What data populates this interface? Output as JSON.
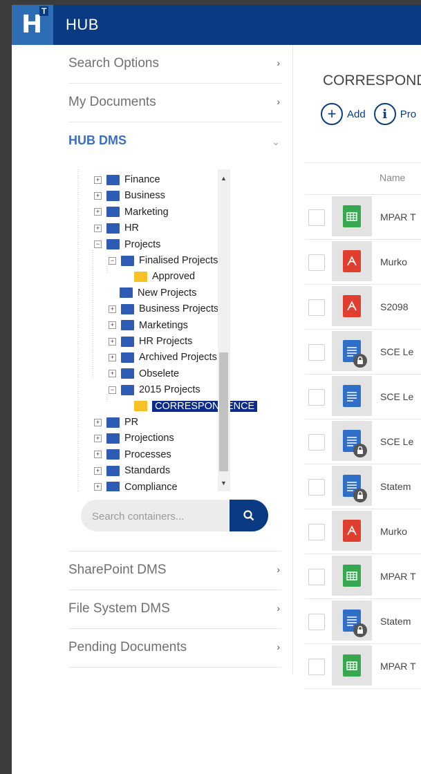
{
  "header": {
    "logo_letter": "H",
    "logo_mark": "T",
    "app_title": "HUB"
  },
  "sidebar": {
    "items_top": [
      {
        "label": "Search Options",
        "chevron": ">"
      },
      {
        "label": "My Documents",
        "chevron": ">"
      },
      {
        "label": "HUB DMS",
        "chevron": "v",
        "active": true
      }
    ],
    "items_bottom": [
      {
        "label": "SharePoint DMS",
        "chevron": ">"
      },
      {
        "label": "File System DMS",
        "chevron": ">"
      },
      {
        "label": "Pending Documents",
        "chevron": ">"
      }
    ]
  },
  "tree": {
    "nodes": [
      {
        "label": "Finance",
        "exp": "+",
        "color": "blue"
      },
      {
        "label": "Business",
        "exp": "+",
        "color": "blue"
      },
      {
        "label": "Marketing",
        "exp": "+",
        "color": "blue"
      },
      {
        "label": "HR",
        "exp": "+",
        "color": "blue"
      },
      {
        "label": "Projects",
        "exp": "-",
        "color": "blue"
      },
      {
        "label": "Finalised Projects",
        "exp": "-",
        "color": "blue"
      },
      {
        "label": "Approved",
        "exp": "",
        "color": "yellow"
      },
      {
        "label": "New Projects",
        "exp": "",
        "color": "blue"
      },
      {
        "label": "Business Projects",
        "exp": "+",
        "color": "blue"
      },
      {
        "label": "Marketings",
        "exp": "+",
        "color": "blue"
      },
      {
        "label": "HR Projects",
        "exp": "+",
        "color": "blue"
      },
      {
        "label": "Archived Projects",
        "exp": "+",
        "color": "blue"
      },
      {
        "label": "Obselete",
        "exp": "+",
        "color": "blue"
      },
      {
        "label": "2015 Projects",
        "exp": "-",
        "color": "blue"
      },
      {
        "label": "CORRESPONDENCE",
        "exp": "",
        "color": "yellow",
        "selected": true
      },
      {
        "label": "PR",
        "exp": "+",
        "color": "blue"
      },
      {
        "label": "Projections",
        "exp": "+",
        "color": "blue"
      },
      {
        "label": "Processes",
        "exp": "+",
        "color": "blue"
      },
      {
        "label": "Standards",
        "exp": "+",
        "color": "blue"
      },
      {
        "label": "Compliance",
        "exp": "+",
        "color": "blue"
      }
    ]
  },
  "search": {
    "placeholder": "Search containers...",
    "icon": "search-icon"
  },
  "main": {
    "title": "CORRESPONDENCE",
    "toolbar": [
      {
        "symbol": "+",
        "label": "Add",
        "icon": "add-icon"
      },
      {
        "symbol": "i",
        "label": "Pro",
        "icon": "info-icon"
      }
    ],
    "columns": [
      "Name"
    ],
    "rows": [
      {
        "type": "sheet",
        "locked": false,
        "name": "MPAR T"
      },
      {
        "type": "pdf",
        "locked": false,
        "name": "Murko"
      },
      {
        "type": "pdf",
        "locked": false,
        "name": "S2098"
      },
      {
        "type": "word",
        "locked": true,
        "name": "SCE Le"
      },
      {
        "type": "word",
        "locked": false,
        "name": "SCE Le"
      },
      {
        "type": "word",
        "locked": true,
        "name": "SCE Le"
      },
      {
        "type": "word",
        "locked": true,
        "name": "Statem"
      },
      {
        "type": "pdf",
        "locked": false,
        "name": "Murko"
      },
      {
        "type": "sheet",
        "locked": false,
        "name": "MPAR T"
      },
      {
        "type": "word",
        "locked": true,
        "name": "Statem"
      },
      {
        "type": "sheet",
        "locked": false,
        "name": "MPAR T"
      }
    ]
  },
  "colors": {
    "brand": "#0a3a82",
    "accent": "#3a6fc2",
    "selected": "#0a2a8c"
  }
}
